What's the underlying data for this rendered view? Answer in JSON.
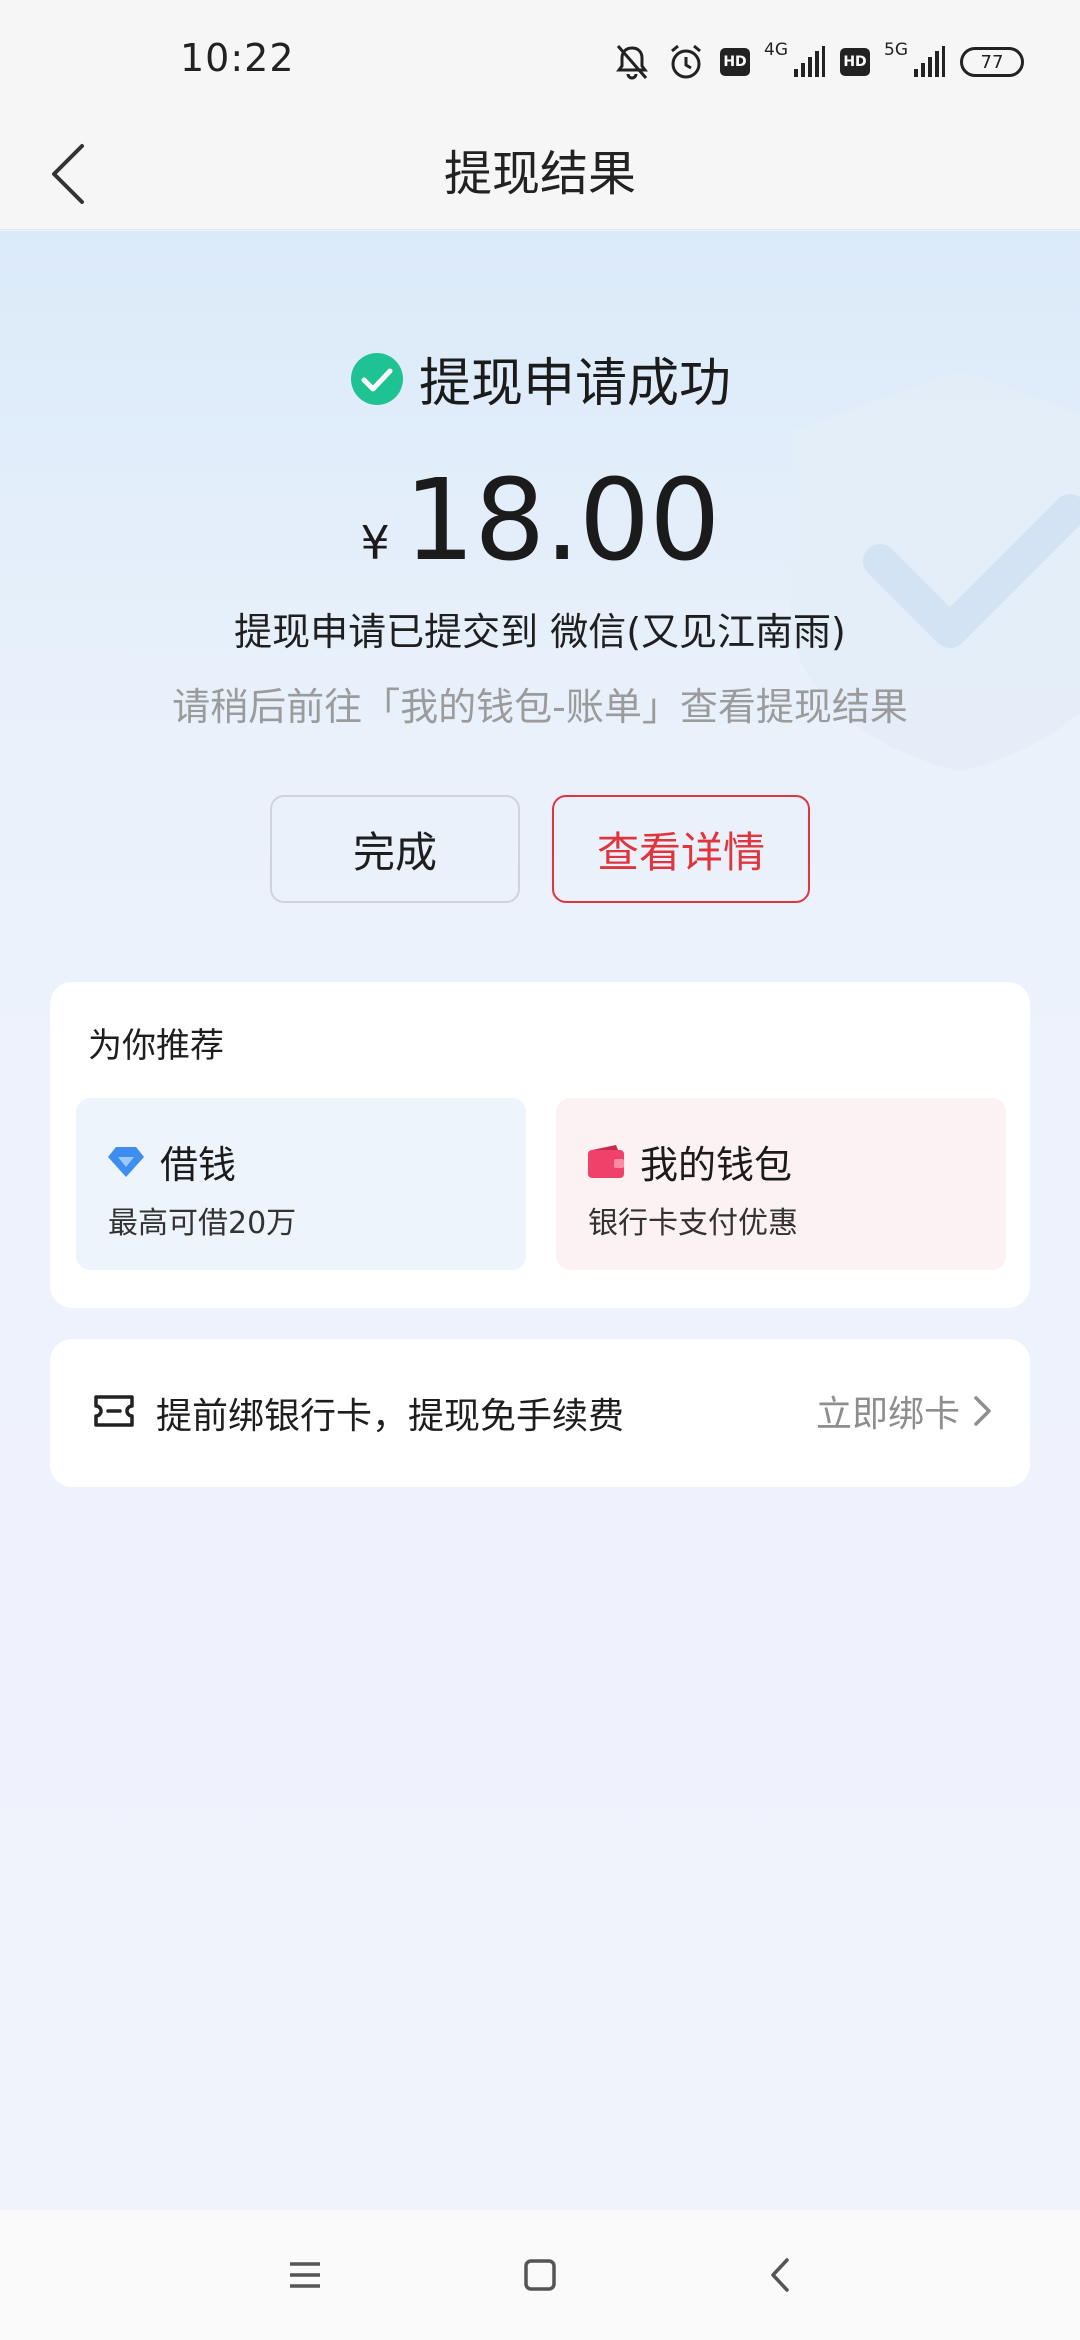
{
  "status_bar": {
    "time": "10:22",
    "network_1": "4G",
    "network_2": "5G",
    "hd_label": "HD",
    "battery": "77"
  },
  "nav": {
    "title": "提现结果"
  },
  "result": {
    "status_text": "提现申请成功",
    "currency_symbol": "¥",
    "amount": "18.00",
    "submitted_text": "提现申请已提交到 微信(又见江南雨)",
    "hint_text": "请稍后前往「我的钱包-账单」查看提现结果"
  },
  "buttons": {
    "done_label": "完成",
    "detail_label": "查看详情"
  },
  "recommend": {
    "title": "为你推荐",
    "items": [
      {
        "title": "借钱",
        "subtitle": "最高可借20万",
        "icon": "diamond-icon"
      },
      {
        "title": "我的钱包",
        "subtitle": "银行卡支付优惠",
        "icon": "wallet-icon"
      }
    ]
  },
  "bind_card": {
    "text": "提前绑银行卡，提现免手续费",
    "action_label": "立即绑卡"
  },
  "colors": {
    "accent_red": "#e0353c",
    "success_green": "#1fc293",
    "borrow_blue": "#3d8ef0",
    "wallet_pink": "#f0416a"
  }
}
